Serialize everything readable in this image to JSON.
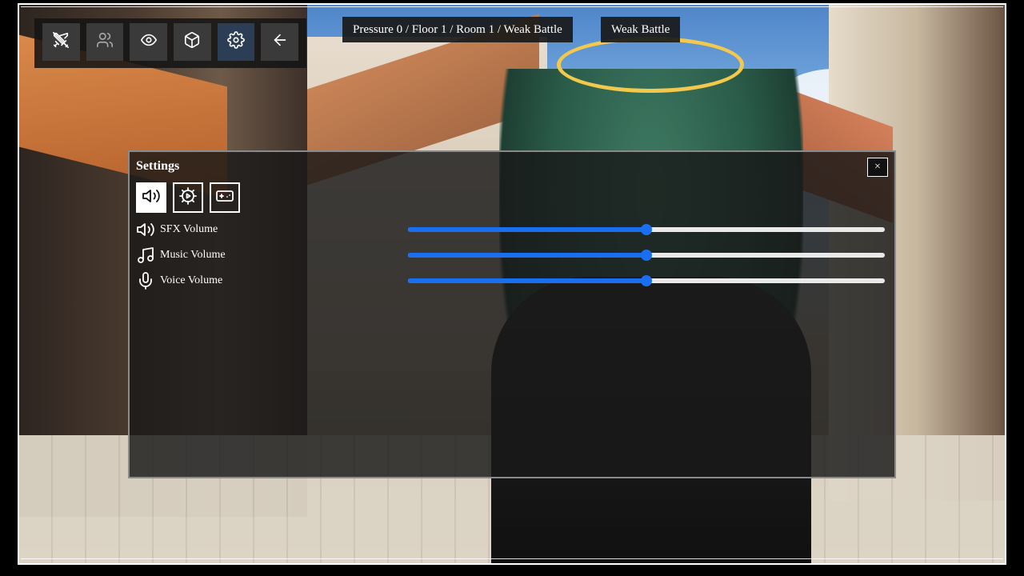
{
  "header": {
    "path_text": "Pressure 0 / Floor 1 / Room 1 / Weak Battle",
    "encounter_text": "Weak Battle"
  },
  "toolbar": {
    "buttons": [
      {
        "icon": "swords-off-icon",
        "state": "normal"
      },
      {
        "icon": "users-icon",
        "state": "disabled"
      },
      {
        "icon": "eye-icon",
        "state": "normal"
      },
      {
        "icon": "box-icon",
        "state": "normal"
      },
      {
        "icon": "gear-icon",
        "state": "active"
      },
      {
        "icon": "arrow-left-icon",
        "state": "normal"
      }
    ]
  },
  "settings": {
    "title": "Settings",
    "close_label": "×",
    "tabs": [
      {
        "icon": "speaker-icon",
        "active": true
      },
      {
        "icon": "gear-play-icon",
        "active": false
      },
      {
        "icon": "gamepad-icon",
        "active": false
      }
    ],
    "sliders": [
      {
        "label": "SFX Volume",
        "icon": "speaker-icon",
        "value": 0.5
      },
      {
        "label": "Music Volume",
        "icon": "music-note-icon",
        "value": 0.5
      },
      {
        "label": "Voice Volume",
        "icon": "microphone-icon",
        "value": 0.5
      }
    ]
  },
  "colors": {
    "accent": "#1a6ff0",
    "panel_bg": "#191919",
    "toolbar_active": "#2c3e55"
  }
}
